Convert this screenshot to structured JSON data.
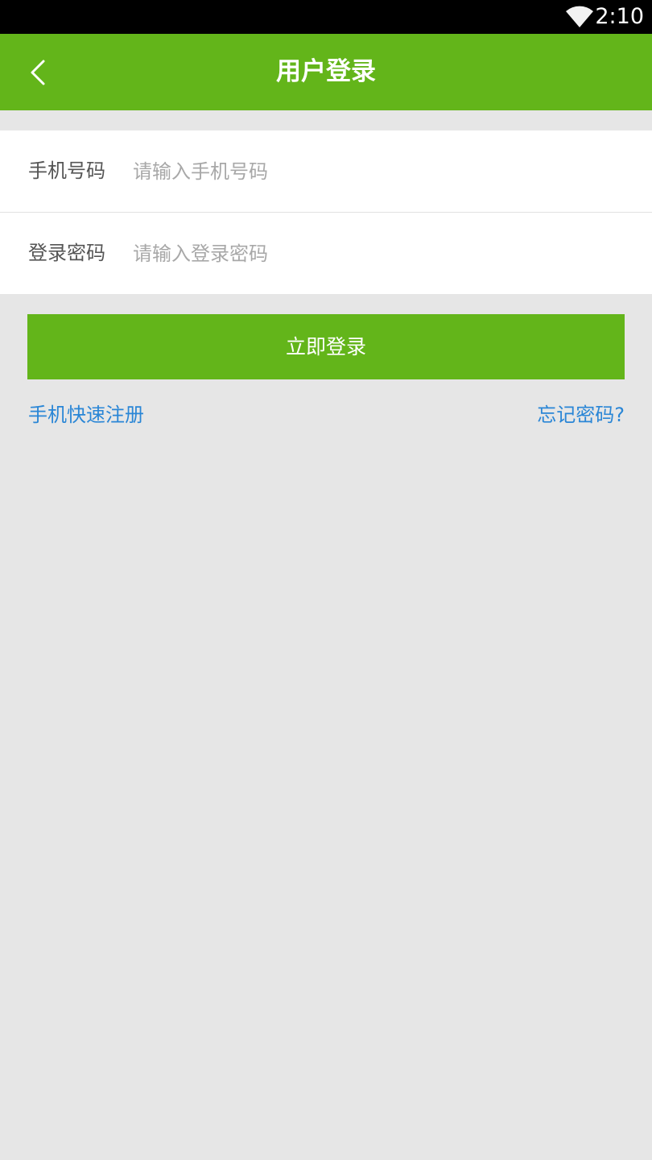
{
  "status_bar": {
    "time": "2:10",
    "wifi_icon": "wifi-icon"
  },
  "header": {
    "back_icon": "chevron-left-icon",
    "title": "用户登录",
    "color": "#63b51a"
  },
  "form": {
    "phone": {
      "label": "手机号码",
      "placeholder": "请输入手机号码",
      "value": ""
    },
    "password": {
      "label": "登录密码",
      "placeholder": "请输入登录密码",
      "value": ""
    }
  },
  "login_button": {
    "label": "立即登录"
  },
  "links": {
    "register": "手机快速注册",
    "forgot_password": "忘记密码?",
    "color": "#2a86d6"
  }
}
